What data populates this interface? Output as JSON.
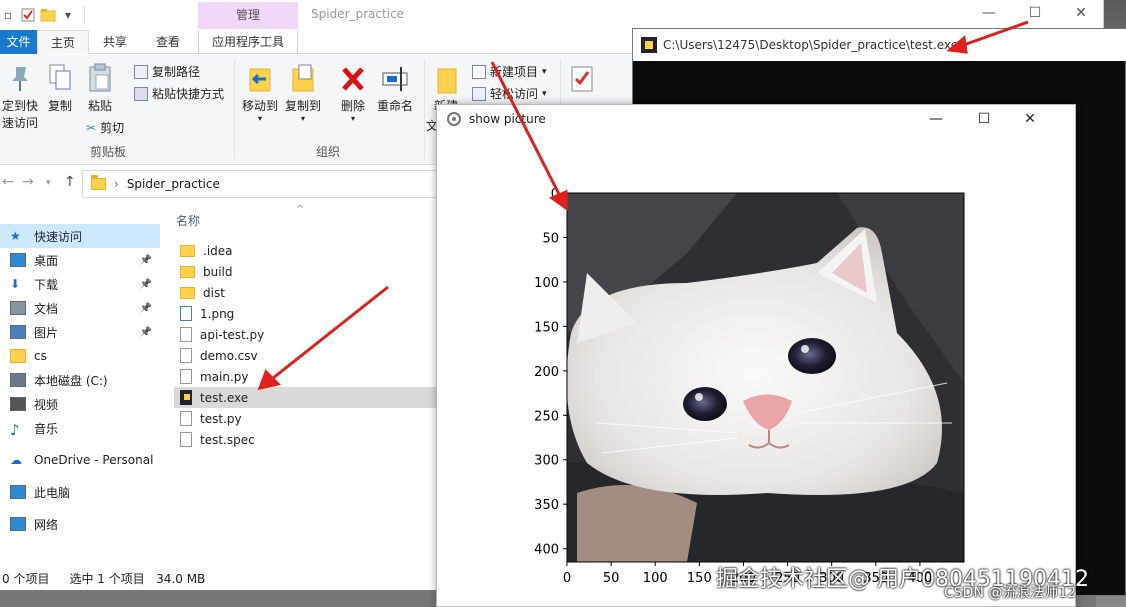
{
  "explorer": {
    "window_title": "Spider_practice",
    "context_tab": "管理",
    "minimize_glyph": "—",
    "maximize_glyph": "☐",
    "close_glyph": "✕",
    "tabs": [
      "文件",
      "主页",
      "共享",
      "查看",
      "应用程序工具"
    ],
    "ribbon": {
      "pin_label_1": "定到快",
      "pin_label_2": "速访问",
      "copy": "复制",
      "paste": "粘贴",
      "copy_path": "复制路径",
      "paste_shortcut": "粘贴快捷方式",
      "cut": "剪切",
      "clipboard_group": "剪贴板",
      "move_to": "移动到",
      "copy_to": "复制到",
      "delete": "删除",
      "rename": "重命名",
      "organize_group": "组织",
      "new_item": "新建项目",
      "easy_access": "轻松访问",
      "new_folder_partial": "新建",
      "new_partial": "文"
    },
    "address": {
      "back": "←",
      "forward": "→",
      "up": "↑",
      "path_sep": "›",
      "folder": "Spider_practice"
    },
    "nav_pane": [
      {
        "label": "快速访问",
        "icon": "star-icon",
        "pinned": false,
        "selected": true
      },
      {
        "label": "桌面",
        "icon": "desktop-icon",
        "pinned": true
      },
      {
        "label": "下载",
        "icon": "download-icon",
        "pinned": true
      },
      {
        "label": "文档",
        "icon": "document-icon",
        "pinned": true
      },
      {
        "label": "图片",
        "icon": "pictures-icon",
        "pinned": true
      },
      {
        "label": "cs",
        "icon": "folder-icon",
        "pinned": false
      },
      {
        "label": "本地磁盘 (C:)",
        "icon": "drive-icon",
        "pinned": false
      },
      {
        "label": "视频",
        "icon": "video-icon",
        "pinned": false
      },
      {
        "label": "音乐",
        "icon": "music-icon",
        "pinned": false
      },
      {
        "label": "OneDrive - Personal",
        "icon": "cloud-icon",
        "pinned": false
      },
      {
        "label": "此电脑",
        "icon": "computer-icon",
        "pinned": false
      },
      {
        "label": "网络",
        "icon": "network-icon",
        "pinned": false
      }
    ],
    "pin_glyph": "📌",
    "column_header": "名称",
    "sort_glyph": "^",
    "files": [
      {
        "name": ".idea",
        "type": "folder"
      },
      {
        "name": "build",
        "type": "folder"
      },
      {
        "name": "dist",
        "type": "folder"
      },
      {
        "name": "1.png",
        "type": "image"
      },
      {
        "name": "api-test.py",
        "type": "file"
      },
      {
        "name": "demo.csv",
        "type": "file"
      },
      {
        "name": "main.py",
        "type": "file"
      },
      {
        "name": "test.exe",
        "type": "exe",
        "selected": true
      },
      {
        "name": "test.py",
        "type": "file"
      },
      {
        "name": "test.spec",
        "type": "file"
      }
    ],
    "status": {
      "items": "0 个项目",
      "selected": "选中 1 个项目",
      "size": "34.0 MB"
    }
  },
  "console": {
    "title": "C:\\Users\\12475\\Desktop\\Spider_practice\\test.exe"
  },
  "show_picture": {
    "title": "show picture",
    "minimize_glyph": "—",
    "maximize_glyph": "☐",
    "close_glyph": "✕"
  },
  "chart_data": {
    "type": "image",
    "y_ticks": [
      "0",
      "50",
      "100",
      "150",
      "200",
      "250",
      "300",
      "350",
      "400"
    ],
    "x_ticks": [
      "0",
      "50",
      "100",
      "150",
      "200",
      "250",
      "300",
      "350",
      "400"
    ],
    "xlim": [
      0,
      450
    ],
    "ylim": [
      0,
      415
    ]
  },
  "watermark": {
    "line1": "掘金技术社区@ 用户080451190412",
    "line2": "CSDN @流浪法师12"
  },
  "colors": {
    "file_tab": "#1979ca",
    "context_tab": "#f0d8f8",
    "selection": "#cce8ff",
    "arrow": "#e02020"
  }
}
